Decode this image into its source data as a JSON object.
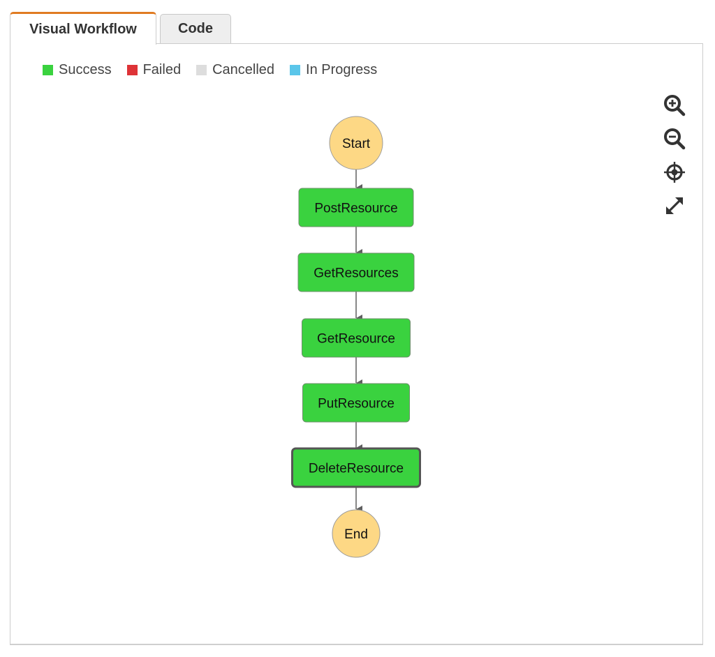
{
  "tabs": [
    {
      "label": "Visual Workflow",
      "active": true
    },
    {
      "label": "Code",
      "active": false
    }
  ],
  "legend": [
    {
      "label": "Success",
      "color": "#3ad23f"
    },
    {
      "label": "Failed",
      "color": "#de3337"
    },
    {
      "label": "Cancelled",
      "color": "#dddddd"
    },
    {
      "label": "In Progress",
      "color": "#5bc6ea"
    }
  ],
  "controls": [
    {
      "name": "zoom-in-icon",
      "label": "Zoom in"
    },
    {
      "name": "zoom-out-icon",
      "label": "Zoom out"
    },
    {
      "name": "center-icon",
      "label": "Center"
    },
    {
      "name": "expand-icon",
      "label": "Expand"
    }
  ],
  "workflow": {
    "nodes": [
      {
        "id": "start",
        "label": "Start",
        "type": "terminal",
        "status": "none"
      },
      {
        "id": "post-resource",
        "label": "PostResource",
        "type": "task",
        "status": "Success"
      },
      {
        "id": "get-resources",
        "label": "GetResources",
        "type": "task",
        "status": "Success"
      },
      {
        "id": "get-resource",
        "label": "GetResource",
        "type": "task",
        "status": "Success"
      },
      {
        "id": "put-resource",
        "label": "PutResource",
        "type": "task",
        "status": "Success"
      },
      {
        "id": "delete-resource",
        "label": "DeleteResource",
        "type": "task",
        "status": "Success",
        "selected": true
      },
      {
        "id": "end",
        "label": "End",
        "type": "terminal",
        "status": "none"
      }
    ],
    "colors": {
      "terminal_fill": "#fdd885",
      "success_fill": "#3ad23f",
      "edge": "#5f5f5f"
    }
  }
}
